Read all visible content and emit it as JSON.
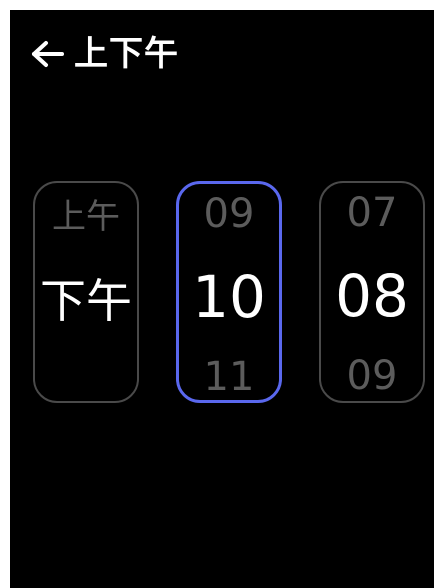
{
  "header": {
    "back_icon": "arrow-left-icon",
    "title": "上下午"
  },
  "pickers": {
    "ampm": {
      "prev": "上午",
      "current": "下午",
      "next": ""
    },
    "hour": {
      "prev": "09",
      "current": "10",
      "next": "11",
      "selected": true
    },
    "minute": {
      "prev": "07",
      "current": "08",
      "next": "09"
    }
  },
  "colors": {
    "background": "#000000",
    "selected_border": "#5a68ee",
    "unselected_border": "#4a4a4a",
    "dim_text": "#5c5c5c",
    "text": "#ffffff"
  }
}
